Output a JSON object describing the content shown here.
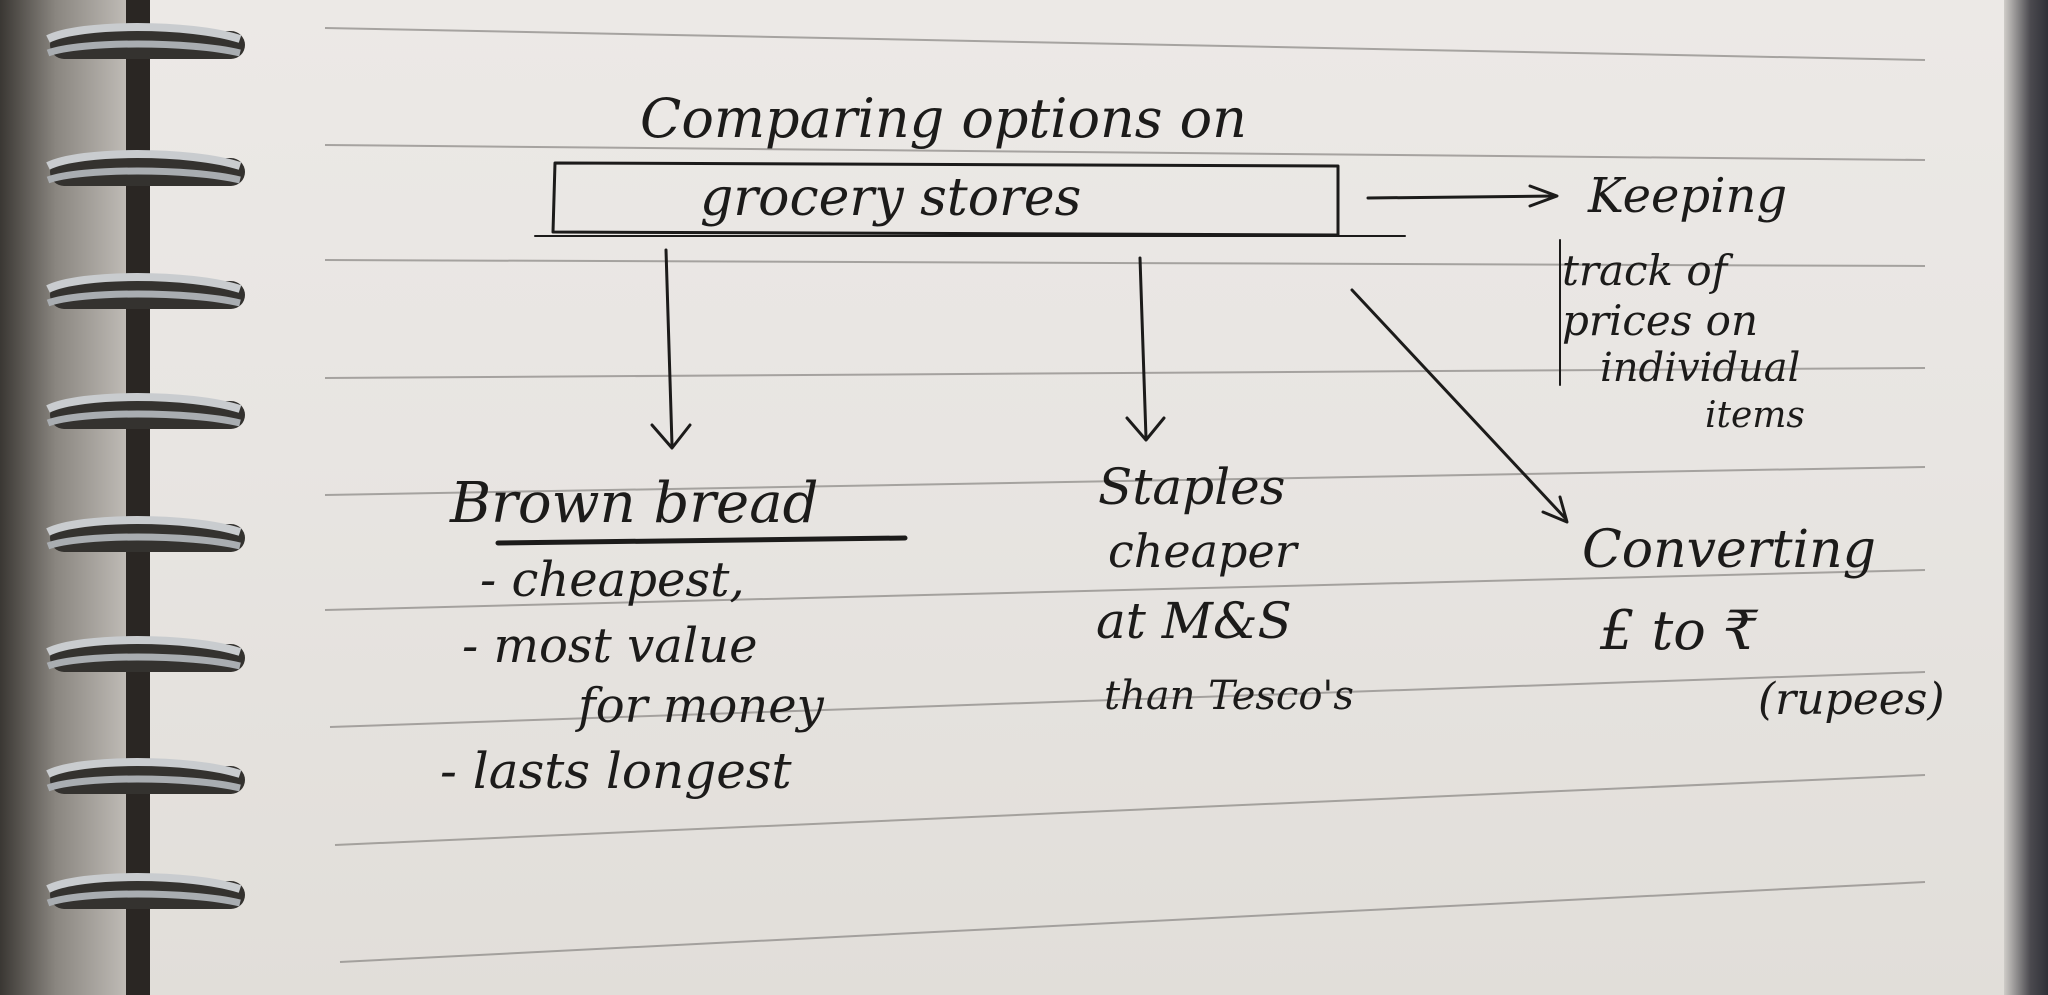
{
  "notebook": {
    "title_line1": "Comparing options on",
    "title_box": "grocery stores",
    "branch_right": [
      "Keeping",
      "track of",
      "prices on",
      "individual",
      "items"
    ],
    "branch_left": [
      "Brown bread",
      "- cheapest,",
      "- most value",
      "for money",
      "- lasts longest"
    ],
    "branch_middle": [
      "Staples",
      "cheaper",
      "at M&S",
      "than Tesco's"
    ],
    "branch_far": [
      "Converting",
      "£ to ₹",
      "(rupees)"
    ]
  }
}
